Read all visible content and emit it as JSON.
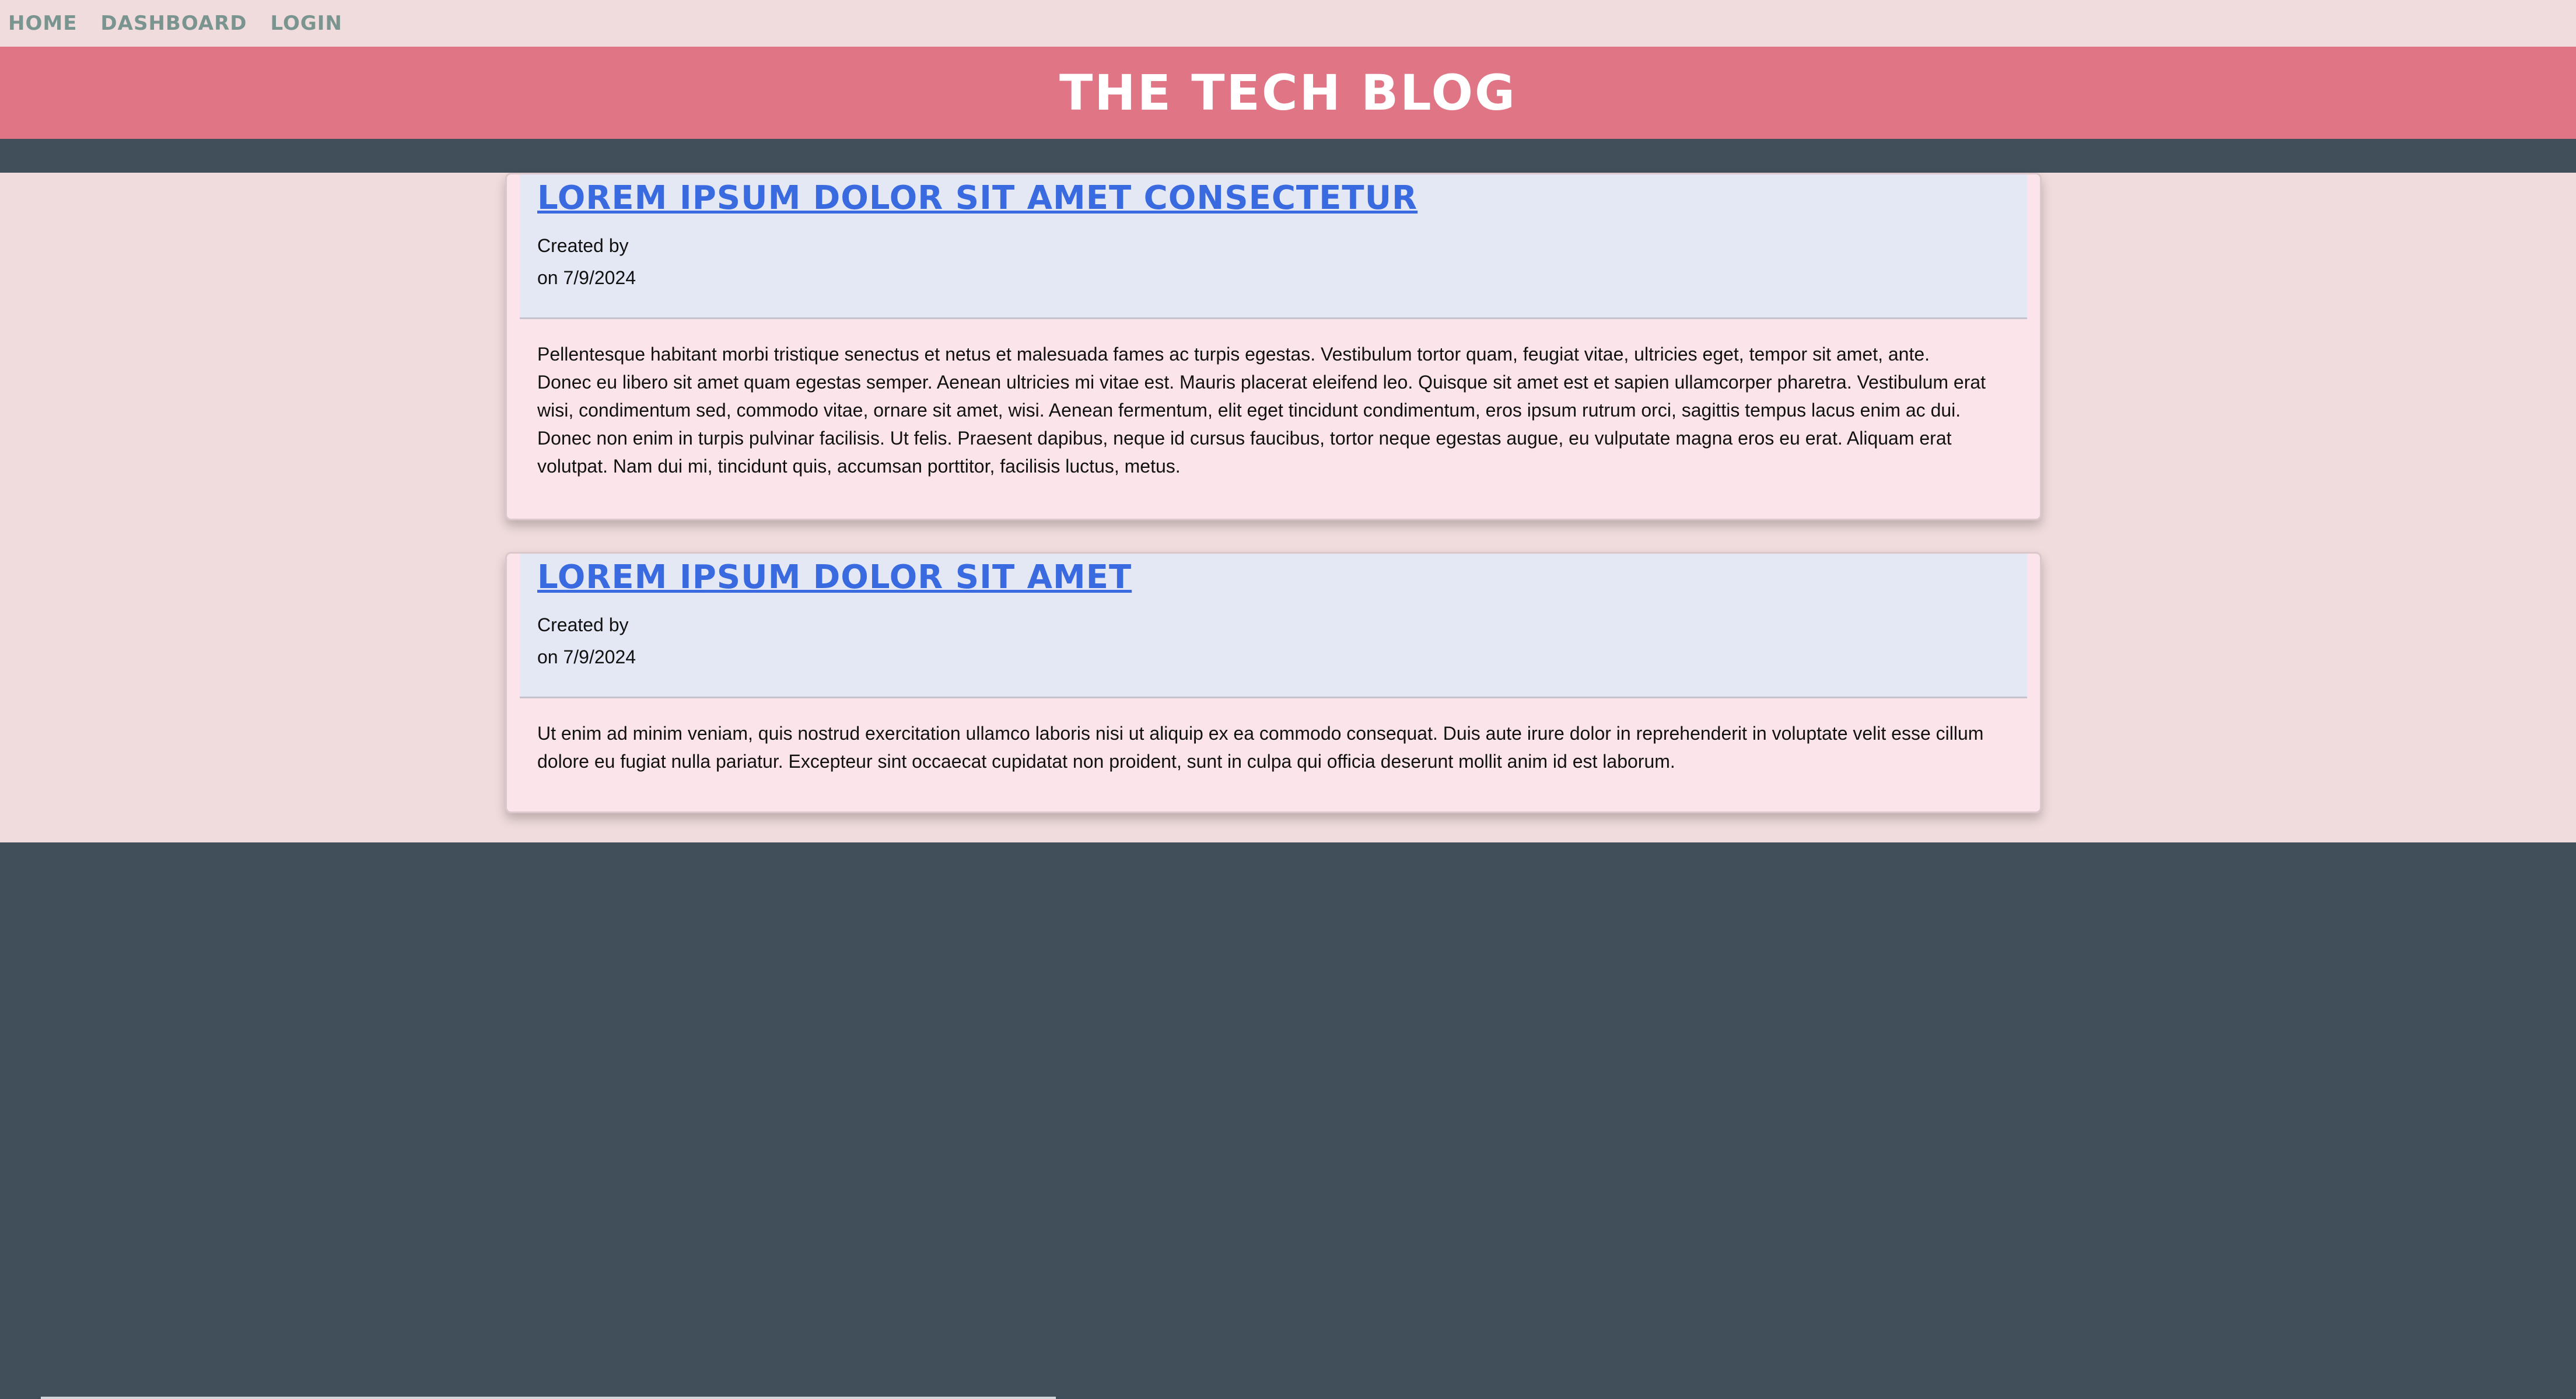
{
  "nav": {
    "items": [
      {
        "label": "HOME"
      },
      {
        "label": "DASHBOARD"
      },
      {
        "label": "LOGIN"
      }
    ]
  },
  "header": {
    "title": "THE TECH BLOG"
  },
  "posts": [
    {
      "title": "LOREM IPSUM DOLOR SIT AMET CONSECTETUR",
      "created_by": "Created by",
      "date": "on 7/9/2024",
      "body": "Pellentesque habitant morbi tristique senectus et netus et malesuada fames ac turpis egestas. Vestibulum tortor quam, feugiat vitae, ultricies eget, tempor sit amet, ante. Donec eu libero sit amet quam egestas semper. Aenean ultricies mi vitae est. Mauris placerat eleifend leo. Quisque sit amet est et sapien ullamcorper pharetra. Vestibulum erat wisi, condimentum sed, commodo vitae, ornare sit amet, wisi. Aenean fermentum, elit eget tincidunt condimentum, eros ipsum rutrum orci, sagittis tempus lacus enim ac dui. Donec non enim in turpis pulvinar facilisis. Ut felis. Praesent dapibus, neque id cursus faucibus, tortor neque egestas augue, eu vulputate magna eros eu erat. Aliquam erat volutpat. Nam dui mi, tincidunt quis, accumsan porttitor, facilisis luctus, metus."
    },
    {
      "title": "LOREM IPSUM DOLOR SIT AMET",
      "created_by": "Created by",
      "date": "on 7/9/2024",
      "body": "Ut enim ad minim veniam, quis nostrud exercitation ullamco laboris nisi ut aliquip ex ea commodo consequat. Duis aute irure dolor in reprehenderit in voluptate velit esse cillum dolore eu fugiat nulla pariatur. Excepteur sint occaecat cupidatat non proident, sunt in culpa qui officia deserunt mollit anim id est laborum."
    }
  ],
  "colors": {
    "nav_bg": "#f0dcdc",
    "header_bg": "#e07586",
    "dark_bg": "#414f5a",
    "card_bg": "#fbe4ea",
    "card_header_bg": "#e4e7f4",
    "link": "#3a6ae0",
    "nav_text": "#7a9590"
  }
}
